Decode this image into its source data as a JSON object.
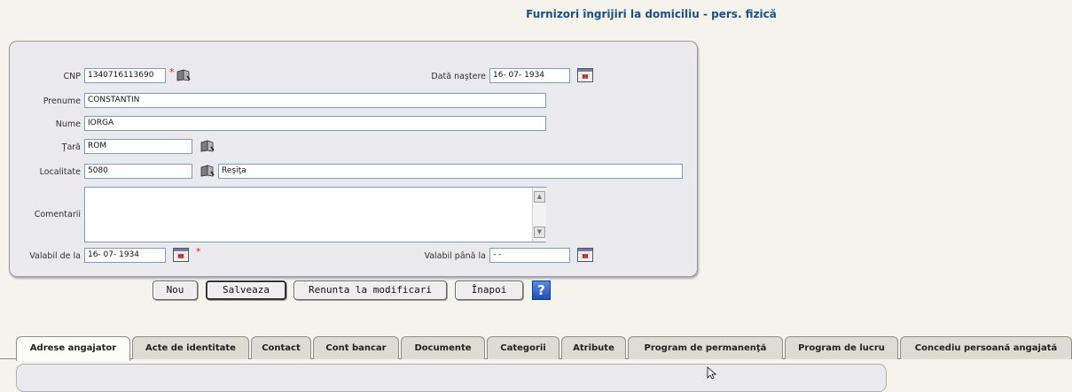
{
  "page": {
    "title": "Furnizori îngrijiri la domiciliu - pers. fizică"
  },
  "form": {
    "cnp_label": "CNP",
    "cnp_value": "1340716113690",
    "birth_label": "Dată naştere",
    "birth_value": "16- 07-  1934",
    "prenume_label": "Prenume",
    "prenume_value": "CONSTANTIN",
    "nume_label": "Nume",
    "nume_value": "IORGA",
    "tara_label": "Ţară",
    "tara_value": "ROM",
    "localitate_label": "Localitate",
    "localitate_code": "5080",
    "localitate_name": "Reşiţa",
    "comentarii_label": "Comentarii",
    "comentarii_value": "",
    "valabil_de_la_label": "Valabil de la",
    "valabil_de_la_value": "16- 07-  1934",
    "valabil_pana_la_label": "Valabil până la",
    "valabil_pana_la_value": "  -   -",
    "required_mark": "*"
  },
  "buttons": {
    "nou": "Nou",
    "salveaza": "Salveaza",
    "renunta": "Renunta la modificari",
    "inapoi": "Înapoi",
    "help": "?"
  },
  "tabs": [
    "Adrese angajator",
    "Acte de identitate",
    "Contact",
    "Cont bancar",
    "Documente",
    "Categorii",
    "Atribute",
    "Program de permanenţă",
    "Program de lucru",
    "Concediu persoană angajată"
  ],
  "colors": {
    "title": "#1c4f86",
    "required": "#e02020",
    "panel": "#e9e9ee",
    "background": "#f4f4ec"
  }
}
